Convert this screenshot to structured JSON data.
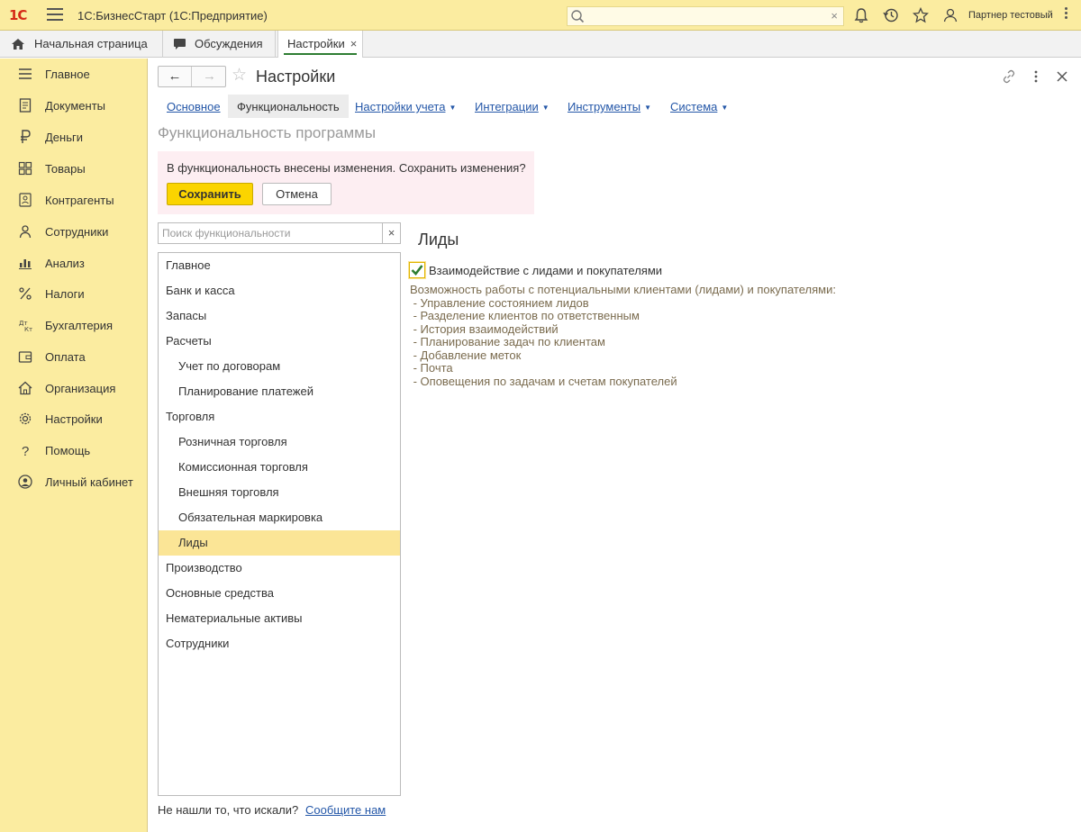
{
  "titlebar": {
    "logo": "1С",
    "app_title": "1С:БизнесСтарт  (1С:Предприятие)",
    "search_placeholder": "",
    "user_name": "Партнер тестовый"
  },
  "tabs": [
    {
      "label": "Начальная страница",
      "icon": "home-icon"
    },
    {
      "label": "Обсуждения",
      "icon": "chat-icon"
    },
    {
      "label": "Настройки",
      "active": true,
      "close": "×"
    }
  ],
  "sidebar": {
    "items": [
      {
        "label": "Главное",
        "icon": "menu-lines-icon"
      },
      {
        "label": "Документы",
        "icon": "document-icon"
      },
      {
        "label": "Деньги",
        "icon": "ruble-icon"
      },
      {
        "label": "Товары",
        "icon": "boxes-icon"
      },
      {
        "label": "Контрагенты",
        "icon": "contacts-icon"
      },
      {
        "label": "Сотрудники",
        "icon": "person-icon"
      },
      {
        "label": "Анализ",
        "icon": "bar-chart-icon"
      },
      {
        "label": "Налоги",
        "icon": "percent-icon"
      },
      {
        "label": "Бухгалтерия",
        "icon": "debit-credit-icon"
      },
      {
        "label": "Оплата",
        "icon": "wallet-icon"
      },
      {
        "label": "Организация",
        "icon": "building-icon"
      },
      {
        "label": "Настройки",
        "icon": "gear-icon"
      },
      {
        "label": "Помощь",
        "icon": "question-icon"
      },
      {
        "label": "Личный кабинет",
        "icon": "account-circle-icon"
      }
    ]
  },
  "form": {
    "title": "Настройки",
    "nav_back": "←",
    "nav_forward": "→",
    "star": "☆",
    "links": [
      {
        "label": "Основное"
      },
      {
        "label": "Функциональность",
        "current": true
      },
      {
        "label": "Настройки учета",
        "dropdown": "▼"
      },
      {
        "label": "Интеграции",
        "dropdown": "▼"
      },
      {
        "label": "Инструменты",
        "dropdown": "▼"
      },
      {
        "label": "Система",
        "dropdown": "▼"
      }
    ],
    "subtitle": "Функциональность программы",
    "banner": {
      "message": "В функциональность внесены изменения. Сохранить изменения?",
      "save_label": "Сохранить",
      "cancel_label": "Отмена"
    },
    "search": {
      "placeholder": "Поиск функциональности",
      "clear": "×"
    },
    "tree": [
      {
        "label": "Главное",
        "level": 0
      },
      {
        "label": "Банк и касса",
        "level": 0
      },
      {
        "label": "Запасы",
        "level": 0
      },
      {
        "label": "Расчеты",
        "level": 0
      },
      {
        "label": "Учет по договорам",
        "level": 1
      },
      {
        "label": "Планирование платежей",
        "level": 1
      },
      {
        "label": "Торговля",
        "level": 0
      },
      {
        "label": "Розничная торговля",
        "level": 1
      },
      {
        "label": "Комиссионная торговля",
        "level": 1
      },
      {
        "label": "Внешняя торговля",
        "level": 1
      },
      {
        "label": "Обязательная маркировка",
        "level": 1
      },
      {
        "label": "Лиды",
        "level": 1,
        "selected": true
      },
      {
        "label": "Производство",
        "level": 0
      },
      {
        "label": "Основные средства",
        "level": 0
      },
      {
        "label": "Нематериальные активы",
        "level": 0
      },
      {
        "label": "Сотрудники",
        "level": 0
      }
    ],
    "footer": {
      "question": "Не нашли то, что искали?",
      "link": "Сообщите нам"
    },
    "section": {
      "heading": "Лиды",
      "checkbox_label": "Взаимодействие с лидами и покупателями",
      "checked": true,
      "description_lines": [
        "Возможность работы с потенциальными клиентами (лидами) и покупателями:",
        " - Управление состоянием лидов",
        " - Разделение клиентов по ответственным",
        " - История взаимодействий",
        " - Планирование задач по клиентам",
        " - Добавление меток",
        " - Почта",
        " - Оповещения по задачам и счетам покупателей"
      ]
    }
  }
}
